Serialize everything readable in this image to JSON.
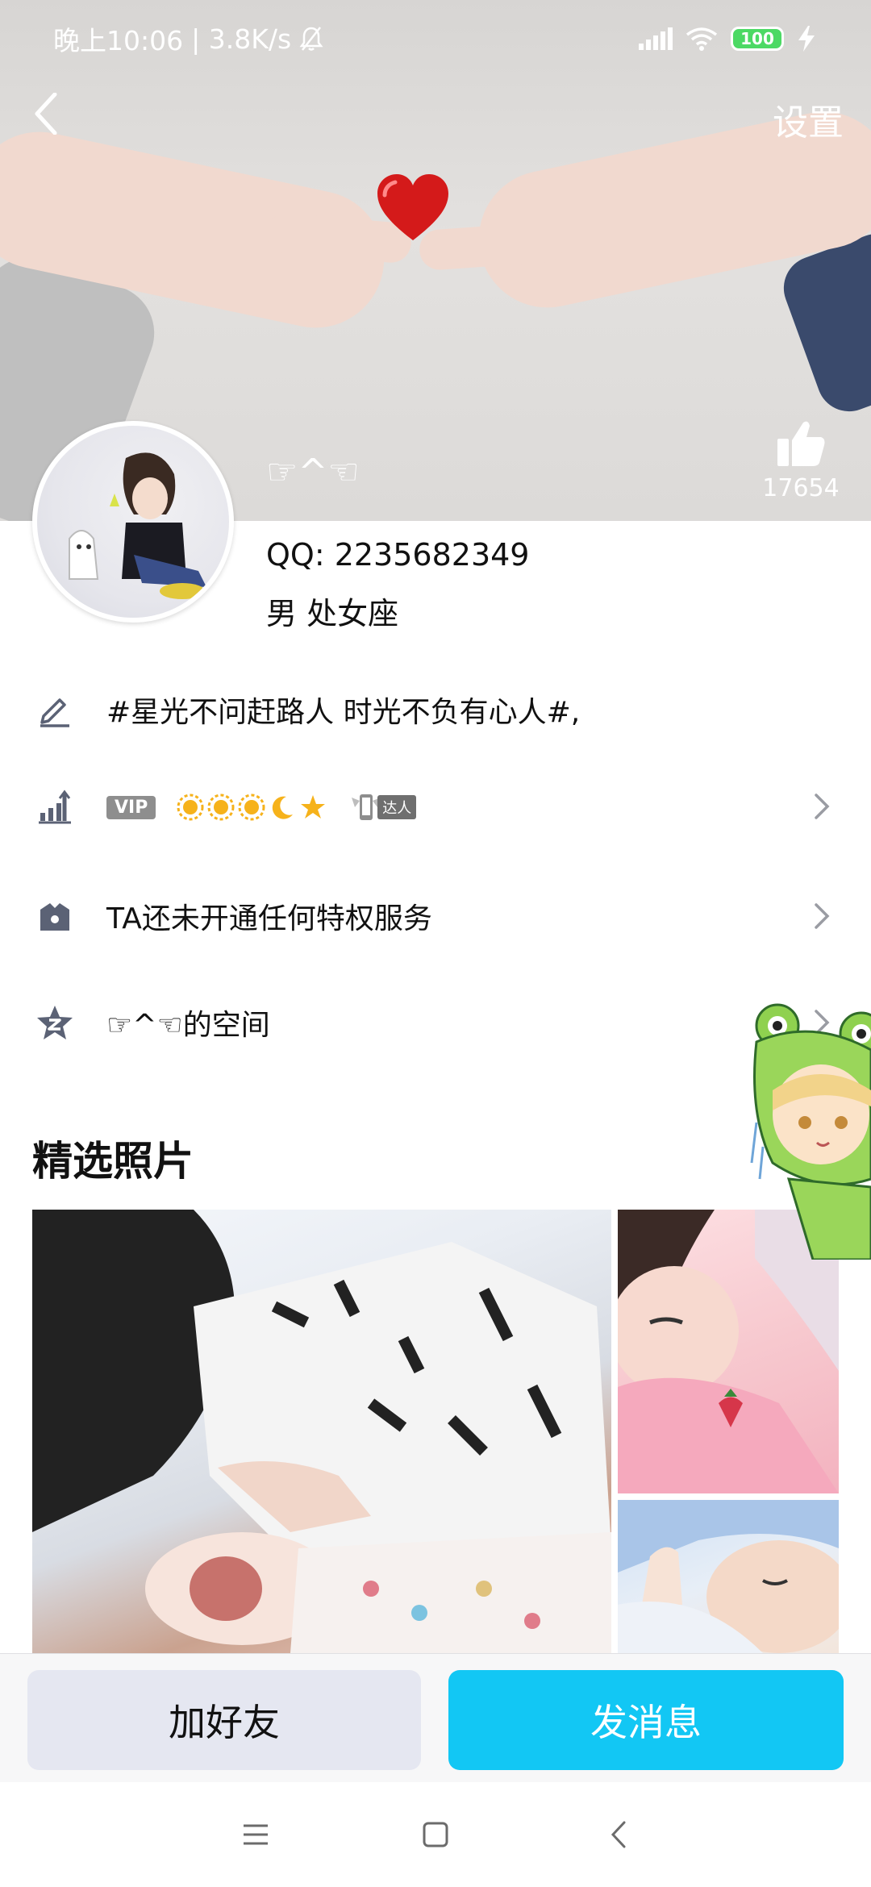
{
  "status_bar": {
    "time": "晚上10:06",
    "speed": "| 3.8K/s",
    "battery": "100"
  },
  "nav": {
    "settings_label": "设置"
  },
  "profile": {
    "nickname": "☞^☜",
    "likes": "17654",
    "qq": "QQ: 2235682349",
    "gender_sign": "男  处女座"
  },
  "rows": {
    "signature": "#星光不问赶路人 时光不负有心人#,",
    "vip_label": "VIP",
    "vip_extra": "达人",
    "privilege": "TA还未开通任何特权服务",
    "space": "☞^☜的空间"
  },
  "section": {
    "title": "精选照片"
  },
  "actions": {
    "add_friend": "加好友",
    "send_message": "发消息"
  },
  "colors": {
    "accent": "#12c7f4",
    "link": "#2f79d6",
    "secondary_btn": "#e5e7f1"
  }
}
